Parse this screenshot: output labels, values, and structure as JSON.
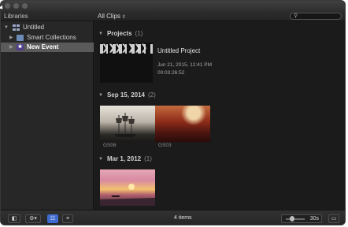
{
  "header": {
    "libraries_label": "Libraries",
    "filter_label": "All Clips"
  },
  "sidebar": {
    "items": [
      {
        "label": "Untitled"
      },
      {
        "label": "Smart Collections"
      },
      {
        "label": "New Event"
      }
    ]
  },
  "browser": {
    "projects": {
      "heading": "Projects",
      "count": "(1)",
      "title": "Untitled Project",
      "date": "Jun 21, 2015, 12:41 PM",
      "duration": "00:03:26:52"
    },
    "group1": {
      "heading": "Sep 15, 2014",
      "count": "(2)",
      "clips": [
        "GS06",
        "GS03"
      ]
    },
    "group2": {
      "heading": "Mar 1, 2012",
      "count": "(1)"
    }
  },
  "toolbar": {
    "items_count": "4 items",
    "zoom_value": "30s",
    "zoom_level": 0.35
  },
  "colors": {
    "accent": "#3e6bd0",
    "selection": "#5a5a5a"
  }
}
